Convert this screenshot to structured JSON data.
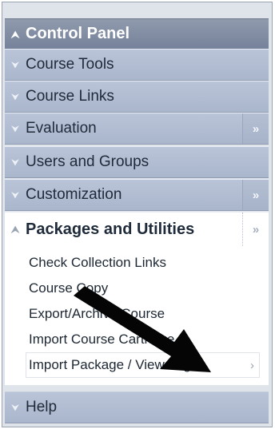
{
  "control_panel": {
    "title": "Control Panel",
    "menu": [
      {
        "label": "Course Tools",
        "has_flyout": false
      },
      {
        "label": "Course Links",
        "has_flyout": false
      },
      {
        "label": "Evaluation",
        "has_flyout": true
      },
      {
        "label": "Users and Groups",
        "has_flyout": false
      },
      {
        "label": "Customization",
        "has_flyout": true
      }
    ],
    "expanded_section": {
      "title": "Packages and Utilities",
      "items": [
        "Check Collection Links",
        "Course Copy",
        "Export/Archive Course",
        "Import Course Cartridge",
        "Import Package / View Logs"
      ],
      "selected_index": 4
    },
    "help_label": "Help"
  },
  "icons": {
    "collapse": "double-chevron-up-icon",
    "expand": "double-chevron-down-icon",
    "flyout": "double-chevron-right-icon"
  },
  "colors": {
    "header_bg": "#8596ad",
    "menu_row_bg": "#b1bdd1",
    "text_dark": "#1f2b3a"
  }
}
